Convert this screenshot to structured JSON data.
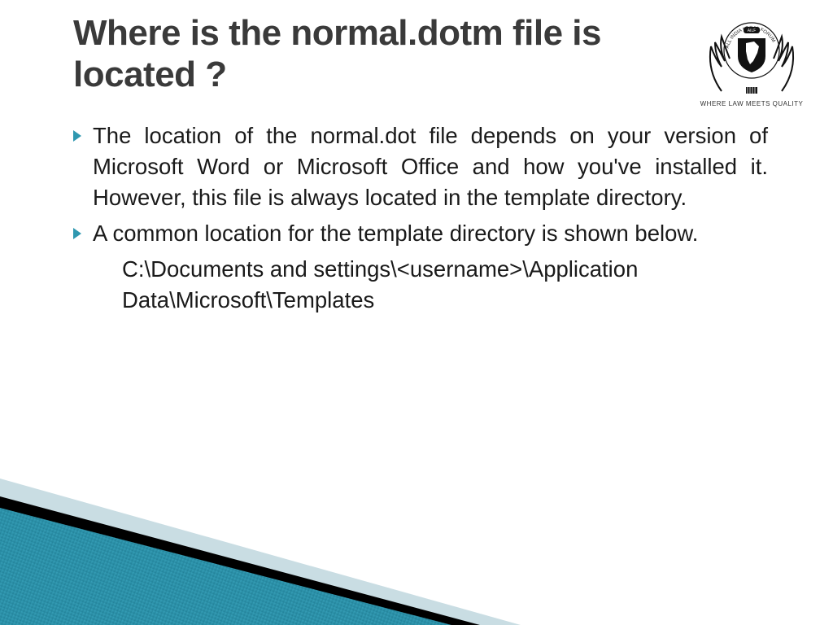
{
  "title": "Where is the normal.dotm file is located ?",
  "logo_tagline": "WHERE LAW MEETS QUALITY",
  "logo_top": "AILF",
  "logo_ring": "ALL INDIA LEGAL FORUM",
  "bullets": [
    "The location of the normal.dot file depends on your version of Microsoft Word or Microsoft Office and how you've installed it. However, this file is always located in the template directory.",
    "A common location for the template directory is shown below."
  ],
  "path_text": "C:\\Documents and settings\\<username>\\Application Data\\Microsoft\\Templates"
}
